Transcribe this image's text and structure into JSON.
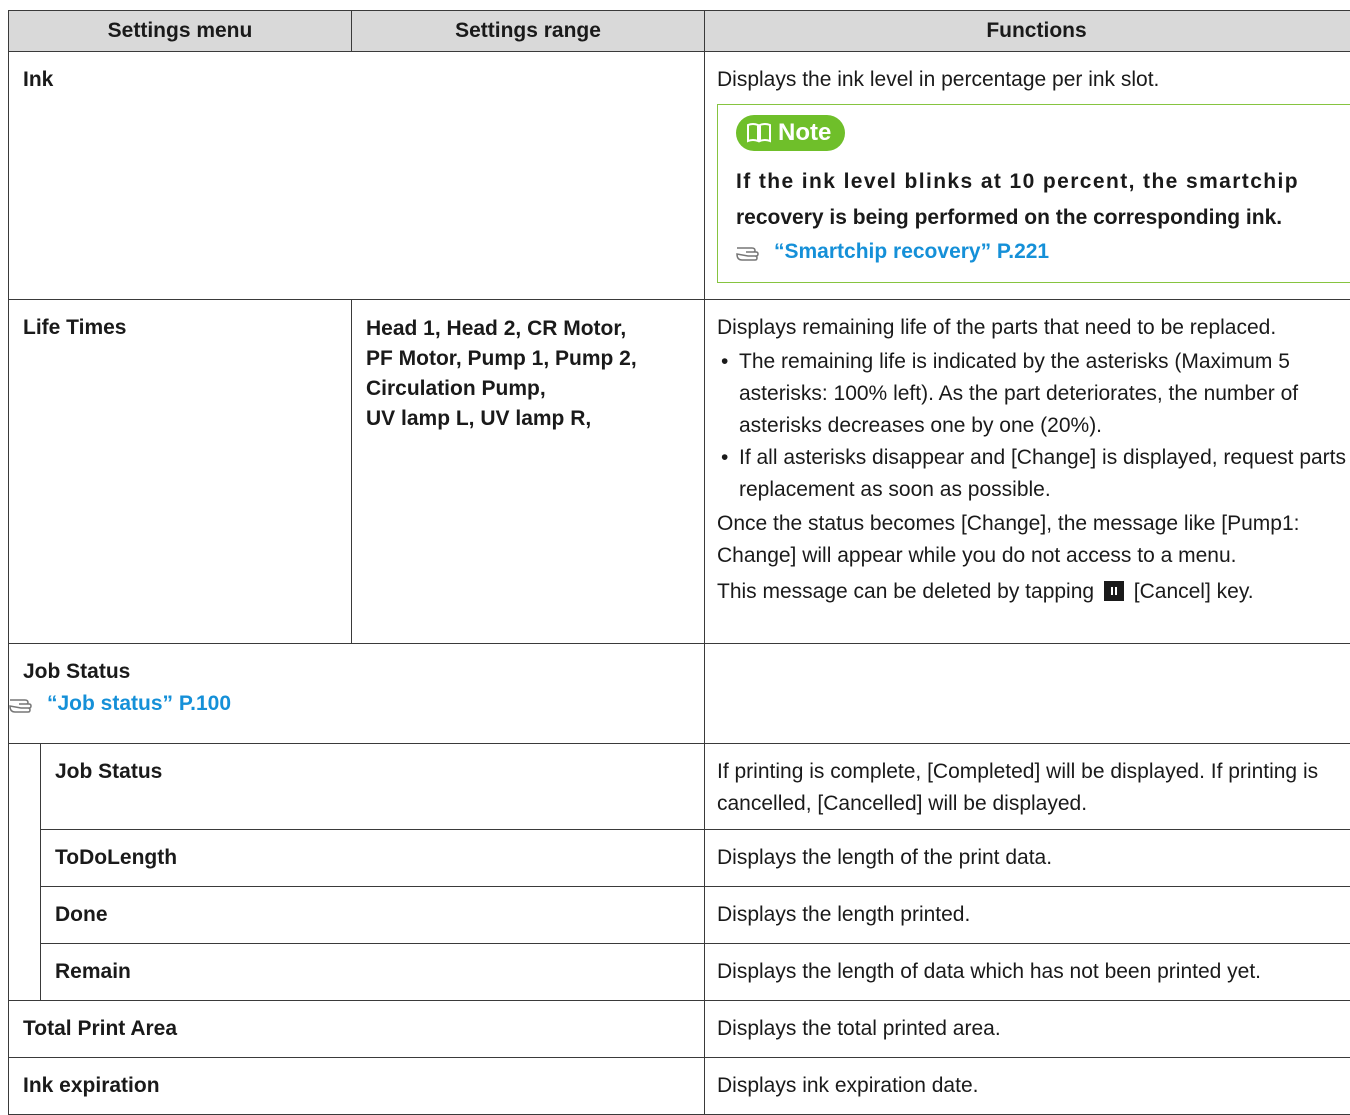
{
  "header": {
    "col1": "Settings menu",
    "col2": "Settings range",
    "col3": "Functions"
  },
  "ink": {
    "label": "Ink",
    "func": "Displays the ink level in percentage per ink slot.",
    "note_label": "Note",
    "note_line1": "If the ink level blinks at 10 percent, the smartchip",
    "note_line2": "recovery is being performed on the corresponding ink.",
    "note_ref": "“Smartchip recovery” P.221"
  },
  "life_times": {
    "label": "Life Times",
    "range_lines": [
      "Head 1, Head 2, CR Motor,",
      "PF Motor, Pump 1, Pump 2,",
      "Circulation Pump,",
      "UV lamp L, UV lamp R,"
    ],
    "func_intro": "Displays remaining life of the parts that need to be replaced.",
    "bullet1": "The remaining life is indicated by the asterisks (Maximum 5 asterisks: 100% left). As the part deteriorates, the number of asterisks decreases one by one (20%).",
    "bullet2": "If all asterisks disappear and  [Change]  is displayed, request parts replacement as soon as possible.",
    "para1": "Once the status becomes [Change], the message like [Pump1: Change] will appear while you do not access to a menu.",
    "para2_before": "This message can be deleted by tapping",
    "para2_after": "[Cancel] key."
  },
  "job_status_group": {
    "label": "Job Status",
    "ref": "“Job status” P.100",
    "rows": [
      {
        "label": "Job Status",
        "func": "If printing is complete, [Completed] will be displayed. If printing is cancelled, [Cancelled] will be displayed."
      },
      {
        "label": "ToDoLength",
        "func": "Displays the length of the print data."
      },
      {
        "label": "Done",
        "func": "Displays the length printed."
      },
      {
        "label": "Remain",
        "func": "Displays the length of data which has not been printed yet."
      }
    ]
  },
  "total_print_area": {
    "label": "Total Print Area",
    "func": "Displays the total printed area."
  },
  "ink_expiration": {
    "label": "Ink expiration",
    "func": "Displays ink expiration date."
  }
}
